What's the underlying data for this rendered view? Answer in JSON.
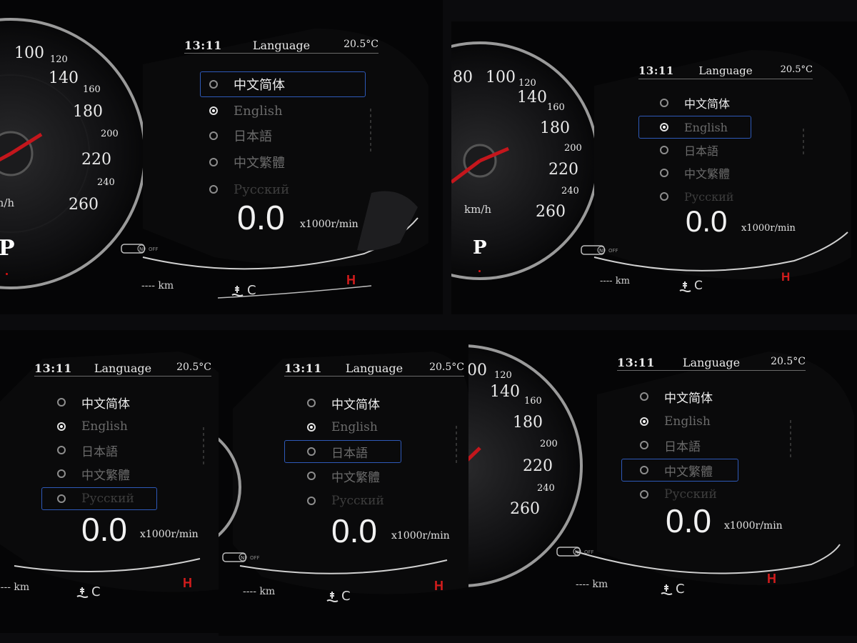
{
  "colors": {
    "accent_highlight": "#2e59b8",
    "hot_red": "#d21c1c",
    "background": "#050506"
  },
  "status": {
    "time": "13:11",
    "title": "Language",
    "temperature": "20.5°C"
  },
  "languages": [
    "中文简体",
    "English",
    "日本語",
    "中文繁體",
    "Русский"
  ],
  "checked_index": 1,
  "tachometer": {
    "value": "0.0",
    "unit": "x1000r/min"
  },
  "odometer": {
    "text": "---- km"
  },
  "coolant": {
    "letter_c": "C",
    "letter_h": "H"
  },
  "speedometer": {
    "unit": "km/h",
    "gear": "P",
    "ticks_panel1": [
      "100",
      "120",
      "140",
      "160",
      "180",
      "200",
      "220",
      "240",
      "260"
    ],
    "ticks_panel2": [
      "80",
      "100",
      "120",
      "140",
      "160",
      "180",
      "200",
      "220",
      "240",
      "260"
    ],
    "ticks_panel5": [
      "00",
      "120",
      "140",
      "160",
      "180",
      "200",
      "220",
      "240",
      "260"
    ]
  },
  "icons": {
    "awd": "car-awd-icon",
    "coolant": "coolant-temperature-icon",
    "radio": "radio-button-icon"
  },
  "panels": [
    {
      "id": "p1",
      "selected_index": 0
    },
    {
      "id": "p2",
      "selected_index": 1
    },
    {
      "id": "p3",
      "selected_index": 4
    },
    {
      "id": "p4",
      "selected_index": 2
    },
    {
      "id": "p5",
      "selected_index": 3
    }
  ]
}
